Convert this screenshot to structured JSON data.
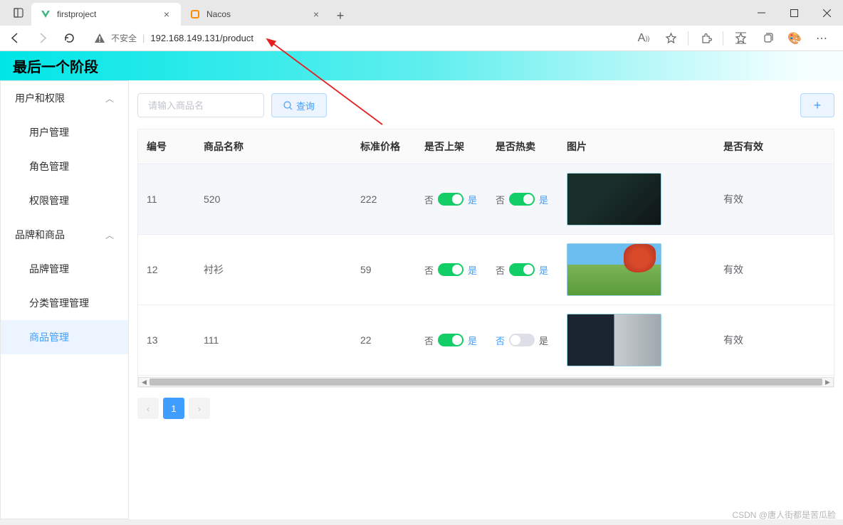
{
  "browser": {
    "tabs": [
      {
        "title": "firstproject",
        "active": true,
        "icon": "vue"
      },
      {
        "title": "Nacos",
        "active": false,
        "icon": "nacos"
      }
    ],
    "url": {
      "insecure_label": "不安全",
      "host_path": "192.168.149.131/product"
    }
  },
  "banner": {
    "title": "最后一个阶段"
  },
  "sidebar": {
    "groups": [
      {
        "label": "用户和权限",
        "open": true,
        "items": [
          "用户管理",
          "角色管理",
          "权限管理"
        ]
      },
      {
        "label": "品牌和商品",
        "open": true,
        "items": [
          "品牌管理",
          "分类管理管理",
          "商品管理"
        ]
      }
    ],
    "active": "商品管理"
  },
  "toolbar": {
    "search_placeholder": "请输入商品名",
    "query_label": "查询",
    "add_label": "+"
  },
  "table": {
    "headers": {
      "id": "编号",
      "name": "商品名称",
      "price": "标准价格",
      "listed": "是否上架",
      "hot": "是否热卖",
      "img": "图片",
      "valid": "是否有效"
    },
    "toggle_labels": {
      "no": "否",
      "yes": "是"
    },
    "rows": [
      {
        "id": "11",
        "name": "520",
        "price": "222",
        "listed": true,
        "hot": true,
        "img": "game",
        "valid": "有效"
      },
      {
        "id": "12",
        "name": "衬衫",
        "price": "59",
        "listed": true,
        "hot": true,
        "img": "mc",
        "valid": "有效"
      },
      {
        "id": "13",
        "name": "111",
        "price": "22",
        "listed": true,
        "hot": false,
        "img": "dark",
        "valid": "有效"
      }
    ]
  },
  "pagination": {
    "page": "1"
  },
  "watermark": "CSDN @唐人街都是苦瓜脸"
}
